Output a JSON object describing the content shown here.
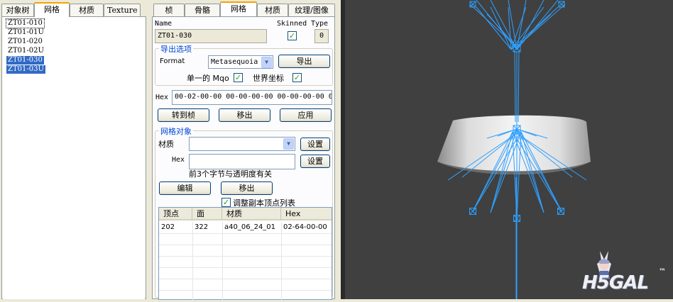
{
  "left_tabs": [
    "对象树",
    "网格",
    "材质",
    "Texture"
  ],
  "left_tabs_active": 1,
  "tree_items": [
    {
      "label": "ZT01-010",
      "selected": false,
      "focus": true
    },
    {
      "label": "ZT01-01U",
      "selected": false,
      "focus": false
    },
    {
      "label": "ZT01-020",
      "selected": false,
      "focus": false
    },
    {
      "label": "ZT01-02U",
      "selected": false,
      "focus": false
    },
    {
      "label": "ZT01-030",
      "selected": true,
      "focus": false
    },
    {
      "label": "ZT01-03U",
      "selected": true,
      "focus": false
    }
  ],
  "right_tabs": [
    "桢",
    "骨骼",
    "网格",
    "材质",
    "纹理/图像"
  ],
  "right_tabs_active": 2,
  "mesh": {
    "name_label": "Name",
    "name_value": "ZT01-030",
    "skinned_label": "Skinned",
    "skinned_checked": true,
    "type_label": "Type",
    "type_value": "0"
  },
  "export": {
    "group_title": "导出选项",
    "format_label": "Format",
    "format_value": "Metasequoia",
    "export_button": "导出",
    "single_mqo_label": "单一的 Mqo",
    "single_mqo_checked": true,
    "world_coords_label": "世界坐标",
    "world_coords_checked": true
  },
  "hex": {
    "label": "Hex",
    "value": "00-02-00-00 00-00-00-00 00-00-00-00 0"
  },
  "actions": {
    "goto_frame": "转到桢",
    "remove": "移出",
    "apply": "应用"
  },
  "mesh_object": {
    "group_title": "网格对象",
    "material_label": "材质",
    "material_value": "",
    "set_button_1": "设置",
    "hex_label": "Hex",
    "hex_value": "",
    "set_button_2": "设置",
    "note": "前3个字节与透明度有关",
    "edit_button": "编辑",
    "remove_button": "移出",
    "adjust_label": "调整副本顶点列表",
    "adjust_checked": true
  },
  "table": {
    "columns": [
      "顶点",
      "面",
      "材质",
      "Hex"
    ],
    "rows": [
      [
        "202",
        "322",
        "a40_06_24_01",
        "02-64-00-00"
      ]
    ]
  },
  "check_glyph": "✓",
  "dropdown_glyph": "▼",
  "watermark": {
    "text": "H5GAL",
    "tm": "™"
  },
  "colors": {
    "selection": "#316ac5",
    "viewport_bg": "#404040",
    "wireframe": "#2ea0ff",
    "group_title": "#0046d5"
  }
}
